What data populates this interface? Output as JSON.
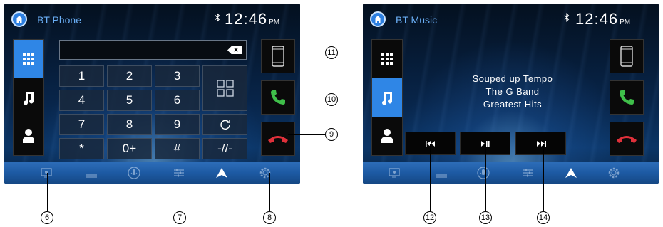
{
  "phone_screen": {
    "title": "BT Phone",
    "bluetooth_icon": "bluetooth-icon",
    "clock": {
      "time": "12:46",
      "ampm": "PM"
    },
    "side_tabs": [
      "dialpad-icon",
      "music-note-icon",
      "contacts-icon"
    ],
    "keypad": [
      [
        "1",
        "2",
        "3"
      ],
      [
        "4",
        "5",
        "6"
      ],
      [
        "7",
        "8",
        "9"
      ],
      [
        "*",
        "0+",
        "#"
      ]
    ],
    "redial_symbol": "C",
    "hangup_key": "-//-",
    "right_buttons": [
      "phone-device-icon",
      "call-answer-icon",
      "call-end-icon"
    ]
  },
  "music_screen": {
    "title": "BT Music",
    "clock": {
      "time": "12:46",
      "ampm": "PM"
    },
    "track": {
      "title": "Souped up Tempo",
      "artist": "The G Band",
      "album": "Greatest Hits"
    },
    "controls": {
      "prev": "I◀◀",
      "play_pause": "▶II",
      "next": "▶▶I"
    }
  },
  "callouts": {
    "c6": "6",
    "c7": "7",
    "c8": "8",
    "c9": "9",
    "c10": "10",
    "c11": "11",
    "c12": "12",
    "c13": "13",
    "c14": "14"
  },
  "colors": {
    "accent_blue": "#2f86e6",
    "call_green": "#3fbf4a",
    "call_red": "#e0303a",
    "title_blue": "#6aaef5"
  }
}
